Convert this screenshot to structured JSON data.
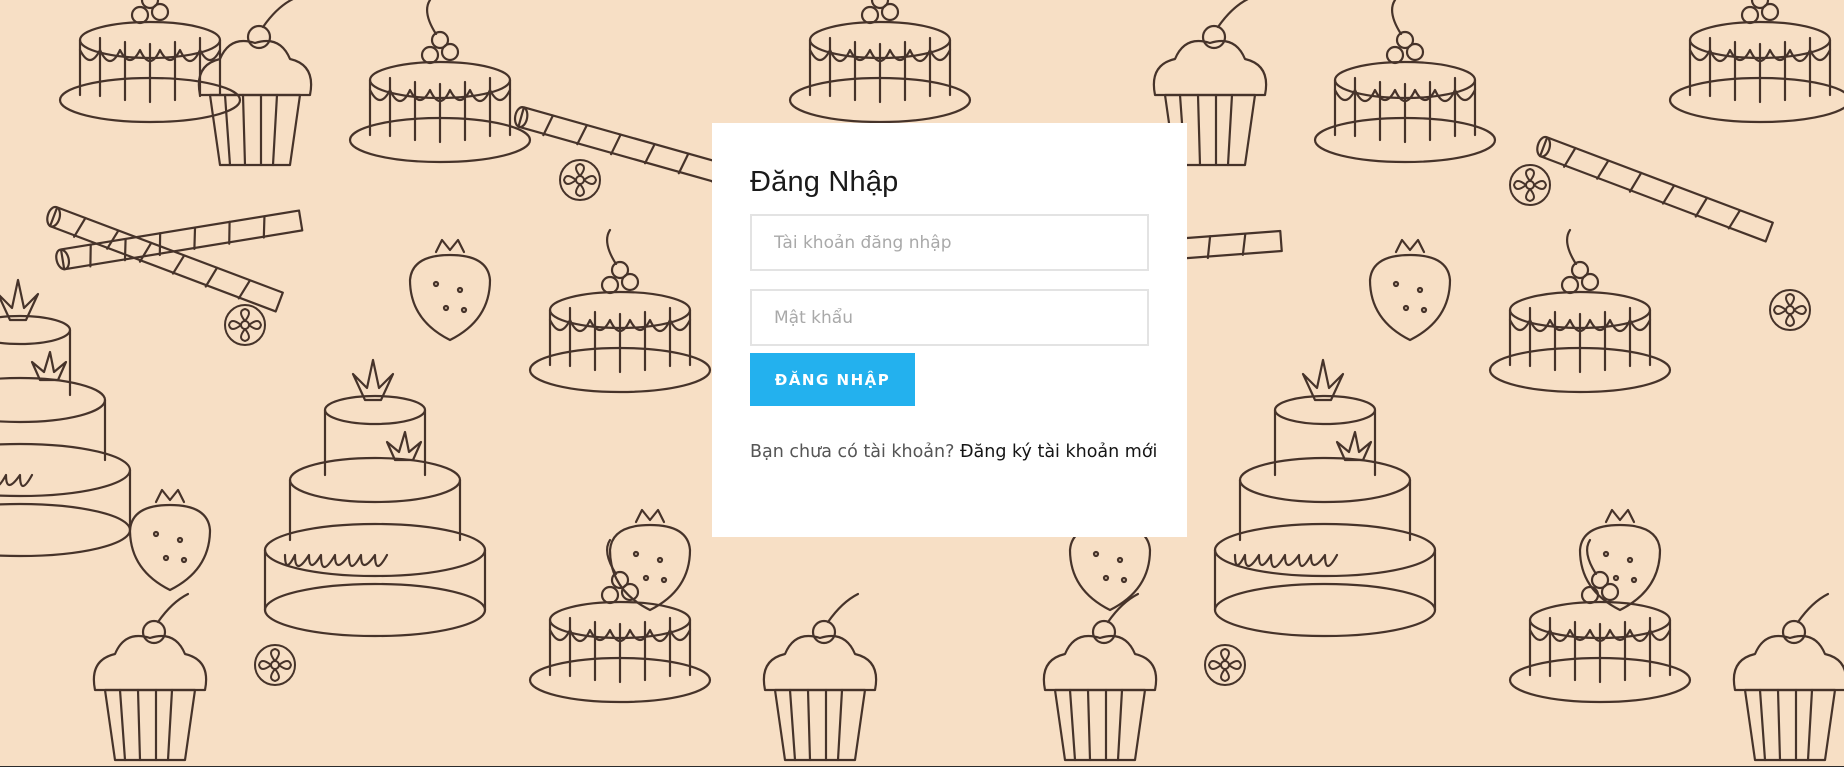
{
  "background": {
    "color": "#f7dfc5",
    "line_color": "#3d2a22",
    "pattern": "cake-dessert-doodle-pattern"
  },
  "login": {
    "title": "Đăng Nhập",
    "username_placeholder": "Tài khoản đăng nhập",
    "password_placeholder": "Mật khẩu",
    "submit_label": "ĐĂNG NHẬP",
    "register_prompt": "Bạn chưa có tài khoản?",
    "register_link": "Đăng ký tài khoản mới",
    "accent_color": "#23b1ee"
  }
}
